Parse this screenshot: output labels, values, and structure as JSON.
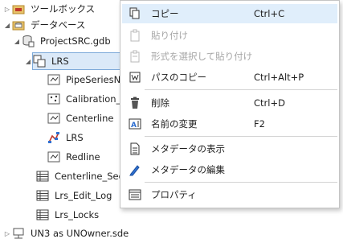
{
  "tree": {
    "toolboxes_label": "ツールボックス",
    "databases_label": "データベース",
    "gdb_label": "ProjectSRC.gdb",
    "dataset_label": "LRS",
    "children": [
      {
        "label": "PipeSeriesNe",
        "icon": "polyline-feature-class-icon"
      },
      {
        "label": "Calibration_P",
        "icon": "point-feature-class-icon"
      },
      {
        "label": "Centerline",
        "icon": "polyline-feature-class-icon"
      },
      {
        "label": "LRS",
        "icon": "lrs-network-icon"
      },
      {
        "label": "Redline",
        "icon": "polyline-feature-class-icon"
      }
    ],
    "tables": [
      {
        "label": "Centerline_Sequ",
        "icon": "table-icon"
      },
      {
        "label": "Lrs_Edit_Log",
        "icon": "table-icon"
      },
      {
        "label": "Lrs_Locks",
        "icon": "table-icon"
      }
    ],
    "sde_label": "UN3 as UNOwner.sde"
  },
  "menu": {
    "items": [
      {
        "label": "コピー",
        "shortcut": "Ctrl+C",
        "icon": "copy-icon",
        "enabled": true
      },
      {
        "label": "貼り付け",
        "shortcut": "",
        "icon": "paste-icon",
        "enabled": false
      },
      {
        "label": "形式を選択して貼り付け",
        "shortcut": "",
        "icon": "paste-special-icon",
        "enabled": false
      },
      {
        "label": "パスのコピー",
        "shortcut": "Ctrl+Alt+P",
        "icon": "copy-path-icon",
        "enabled": true
      },
      {
        "label": "削除",
        "shortcut": "Ctrl+D",
        "icon": "delete-icon",
        "enabled": true
      },
      {
        "label": "名前の変更",
        "shortcut": "F2",
        "icon": "rename-icon",
        "enabled": true
      },
      {
        "label": "メタデータの表示",
        "shortcut": "",
        "icon": "view-metadata-icon",
        "enabled": true
      },
      {
        "label": "メタデータの編集",
        "shortcut": "",
        "icon": "edit-metadata-icon",
        "enabled": true
      },
      {
        "label": "プロパティ",
        "shortcut": "",
        "icon": "properties-icon",
        "enabled": true
      }
    ]
  },
  "colors": {
    "highlight": "#e0eefb",
    "selection": "#dbe9f8",
    "selection_border": "#7eaad9",
    "disabled_text": "#a6a6a6"
  }
}
